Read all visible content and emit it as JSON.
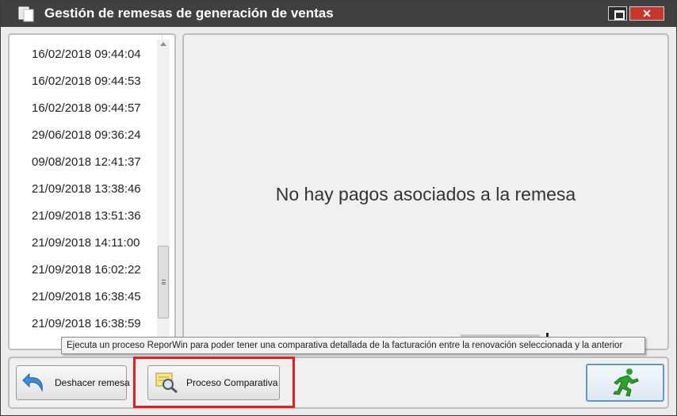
{
  "window": {
    "title": "Gestión de remesas de generación de ventas",
    "close_label": "✕"
  },
  "remesas": {
    "items": [
      "16/02/2018 09:44:04",
      "16/02/2018 09:44:53",
      "16/02/2018 09:44:57",
      "29/06/2018 09:36:24",
      "09/08/2018 12:41:37",
      "21/09/2018 13:38:46",
      "21/09/2018 13:51:36",
      "21/09/2018 14:11:00",
      "21/09/2018 16:02:22",
      "21/09/2018 16:38:45",
      "21/09/2018 16:38:59"
    ]
  },
  "pagos": {
    "empty_message": "No hay pagos asociados a la remesa"
  },
  "tooltip": {
    "text": "Ejecuta un proceso ReporWin para poder tener una comparativa detallada de la facturación entre la renovación seleccionada y la anterior"
  },
  "toolbar": {
    "undo_label": "Deshacer remesa",
    "compare_label": "Proceso Comparativa"
  },
  "colors": {
    "titlebar": "#404040",
    "close": "#c8352d",
    "highlight": "#e02020",
    "run_icon": "#2aa52a",
    "undo_icon": "#3a8fd8"
  },
  "icons": {
    "window": "documents-icon",
    "undo": "undo-arrow-icon",
    "compare": "magnifier-document-icon",
    "run": "running-man-icon"
  }
}
